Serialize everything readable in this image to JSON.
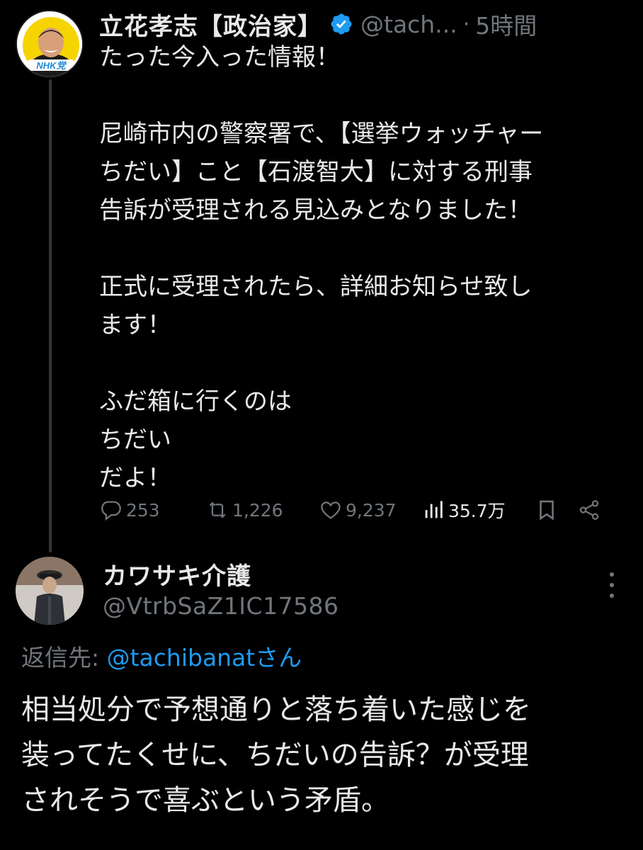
{
  "tweet": {
    "display_name": "立花孝志【政治家】",
    "handle": "@tach...",
    "separator": "·",
    "time": "5時間",
    "avatar_badge_text": "NHK党",
    "paragraphs": [
      "たった今入った情報！",
      "尼崎市内の警察署で、【選挙ウォッチャー\nちだい】こと【石渡智大】に対する刑事\n告訴が受理される見込みとなりました！",
      "正式に受理されたら、詳細お知らせ致し\nます！",
      "ふだ箱に行くのは\nちだい\nだよ！"
    ],
    "actions": {
      "replies": "253",
      "retweets": "1,226",
      "likes": "9,237",
      "views": "35.7万"
    }
  },
  "reply": {
    "display_name": "カワサキ介護",
    "handle": "@VtrbSaZ1IC17586",
    "reply_to_prefix": "返信先: ",
    "reply_to_mention": "@tachibanat",
    "reply_to_suffix": "さん",
    "text": "相当処分で予想通りと落ち着いた感じを\n装ってたくせに、ちだいの告訴？が受理\nされそうで喜ぶという矛盾。"
  },
  "icons": {
    "verified": "verified-badge-icon",
    "reply": "reply-icon",
    "retweet": "retweet-icon",
    "like": "heart-icon",
    "views": "views-icon",
    "bookmark": "bookmark-icon",
    "share": "share-icon",
    "more": "more-icon"
  },
  "colors": {
    "background": "#000000",
    "text": "#e7e9ea",
    "muted": "#71767b",
    "link": "#1d9bf0",
    "verified": "#1d9bf0",
    "avatar_badge": "#1e8bd6"
  }
}
